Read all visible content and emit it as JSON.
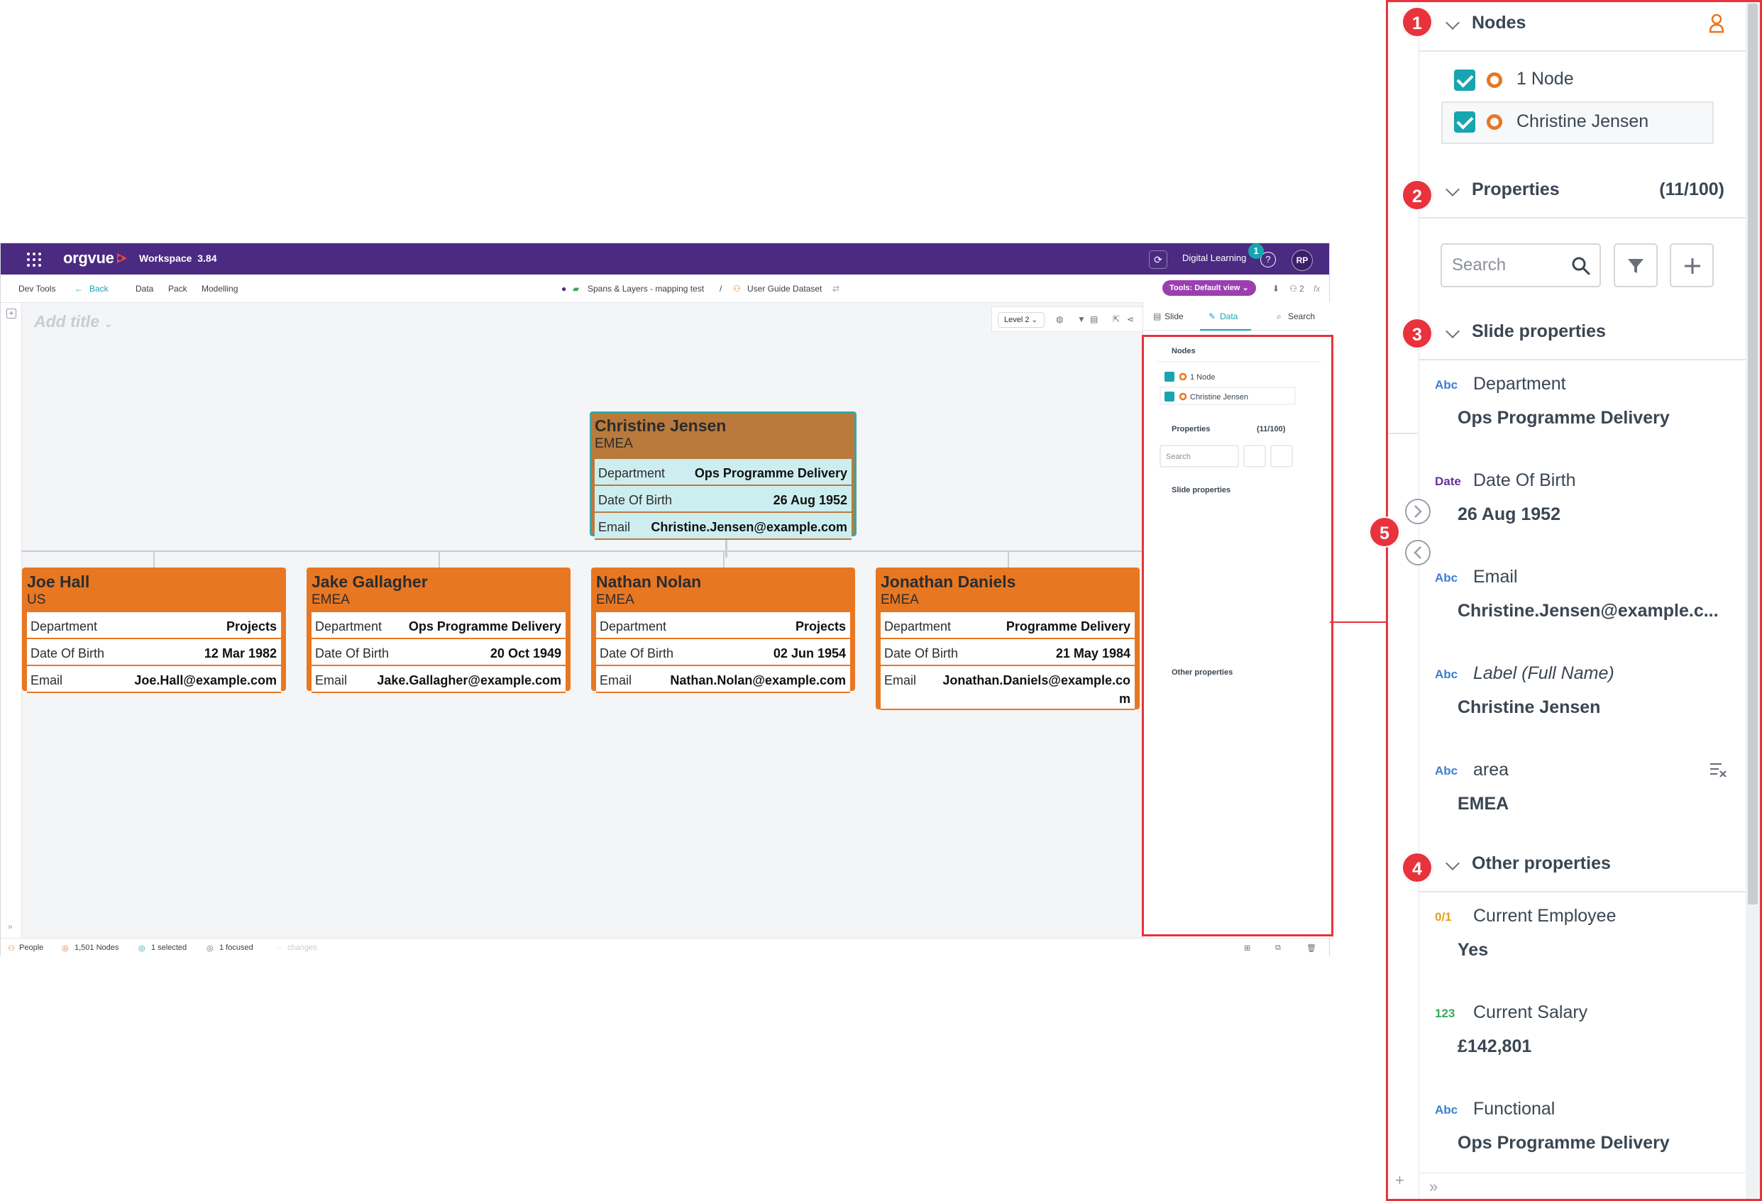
{
  "topbar": {
    "logo": "orgvue",
    "workspace": "Workspace",
    "version": "3.84",
    "digital_learning": "Digital Learning",
    "notification_count": "1",
    "help": "?",
    "avatar": "RP"
  },
  "menubar": {
    "dev_tools": "Dev Tools",
    "back": "Back",
    "data": "Data",
    "pack": "Pack",
    "modelling": "Modelling",
    "breadcrumb_1": "Spans & Layers - mapping test",
    "separator": "/",
    "breadcrumb_2": "User Guide Dataset",
    "tools_view": "Tools: Default view",
    "users_count": "2",
    "fx": "fx"
  },
  "canvas": {
    "add_title": "Add title",
    "level": "Level 2"
  },
  "cards": {
    "root": {
      "name": "Christine Jensen",
      "region": "EMEA",
      "rows": [
        {
          "k": "Department",
          "v": "Ops Programme Delivery"
        },
        {
          "k": "Date Of Birth",
          "v": "26 Aug 1952"
        },
        {
          "k": "Email",
          "v": "Christine.Jensen@example.com"
        }
      ]
    },
    "children": [
      {
        "name": "Joe Hall",
        "region": "US",
        "rows": [
          {
            "k": "Department",
            "v": "Projects"
          },
          {
            "k": "Date Of Birth",
            "v": "12 Mar 1982"
          },
          {
            "k": "Email",
            "v": "Joe.Hall@example.com"
          }
        ]
      },
      {
        "name": "Jake Gallagher",
        "region": "EMEA",
        "rows": [
          {
            "k": "Department",
            "v": "Ops Programme Delivery"
          },
          {
            "k": "Date Of Birth",
            "v": "20 Oct 1949"
          },
          {
            "k": "Email",
            "v": "Jake.Gallagher@example.com"
          }
        ]
      },
      {
        "name": "Nathan Nolan",
        "region": "EMEA",
        "rows": [
          {
            "k": "Department",
            "v": "Projects"
          },
          {
            "k": "Date Of Birth",
            "v": "02 Jun 1954"
          },
          {
            "k": "Email",
            "v": "Nathan.Nolan@example.com"
          }
        ]
      },
      {
        "name": "Jonathan Daniels",
        "region": "EMEA",
        "rows": [
          {
            "k": "Department",
            "v": "Programme Delivery"
          },
          {
            "k": "Date Of Birth",
            "v": "21 May 1984"
          },
          {
            "k": "Email",
            "v": "Jonathan.Daniels@example.co",
            "v2": "m"
          }
        ]
      }
    ]
  },
  "sidetabs": {
    "slide": "Slide",
    "data": "Data",
    "search": "Search"
  },
  "status": {
    "people": "People",
    "nodes": "1,501 Nodes",
    "selected": "1 selected",
    "focused": "1 focused",
    "changes": "changes"
  },
  "panel": {
    "nodes_title": "Nodes",
    "node_items": [
      "1 Node",
      "Christine Jensen"
    ],
    "properties_title": "Properties",
    "properties_count": "(11/100)",
    "search_placeholder": "Search",
    "slide_properties_title": "Slide properties",
    "slide_properties": [
      {
        "type": "Abc",
        "name": "Department",
        "value": "Ops Programme Delivery"
      },
      {
        "type": "Date",
        "name": "Date Of Birth",
        "value": "26 Aug 1952"
      },
      {
        "type": "Abc",
        "name": "Email",
        "value": "Christine.Jensen@example.c..."
      },
      {
        "type": "Abc",
        "name": "Label (Full Name)",
        "value": "Christine Jensen"
      },
      {
        "type": "Abc",
        "name": "area",
        "value": "EMEA"
      }
    ],
    "other_properties_title": "Other properties",
    "other_properties": [
      {
        "type": "0/1",
        "name": "Current Employee",
        "value": "Yes"
      },
      {
        "type": "123",
        "name": "Current Salary",
        "value": "£142,801"
      },
      {
        "type": "Abc",
        "name": "Functional",
        "value": "Ops Programme Delivery"
      }
    ]
  },
  "badges": [
    "1",
    "2",
    "3",
    "4",
    "5"
  ],
  "colors": {
    "brand": "#4b2a82",
    "accent": "#17a5b0",
    "card_orange": "#e87722",
    "card_selected": "#b97a3c",
    "highlight": "#e8333c"
  }
}
